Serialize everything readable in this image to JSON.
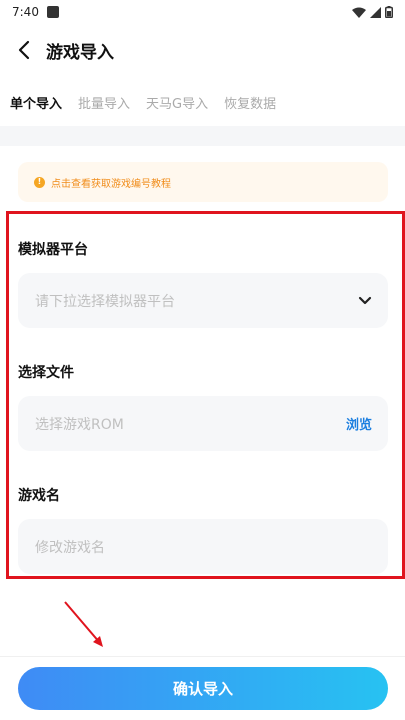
{
  "status_bar": {
    "time": "7:40"
  },
  "header": {
    "title": "游戏导入"
  },
  "tabs": [
    {
      "label": "单个导入",
      "active": true
    },
    {
      "label": "批量导入",
      "active": false
    },
    {
      "label": "天马G导入",
      "active": false
    },
    {
      "label": "恢复数据",
      "active": false
    }
  ],
  "notice": {
    "icon": "info-icon",
    "text": "点击查看获取游戏编号教程"
  },
  "form": {
    "platform": {
      "label": "模拟器平台",
      "placeholder": "请下拉选择模拟器平台"
    },
    "file": {
      "label": "选择文件",
      "placeholder": "选择游戏ROM",
      "browse_label": "浏览"
    },
    "name": {
      "label": "游戏名",
      "placeholder": "修改游戏名"
    }
  },
  "confirm_button": {
    "label": "确认导入"
  },
  "colors": {
    "accent": "#1c7fe0",
    "button_gradient_start": "#3f8bf5",
    "button_gradient_end": "#27c2f2",
    "notice_text": "#f08c1a",
    "annotation_red": "#e0141e"
  }
}
